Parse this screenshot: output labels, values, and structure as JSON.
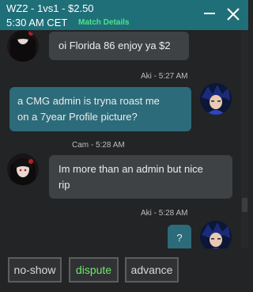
{
  "header": {
    "title": "WZ2 - 1vs1 - $2.50",
    "time": "5:30 AM CET",
    "details_link": "Match Details",
    "minimize_icon": "minimize-icon",
    "close_icon": "close-icon"
  },
  "messages": [
    {
      "author": "",
      "time": "",
      "side": "left",
      "text": "oi Florida 86 enjoy ya $2"
    },
    {
      "author": "Aki",
      "time": "5:27 AM",
      "meta": "Aki - 5:27 AM",
      "side": "right",
      "text_lines": [
        "a CMG admin is tryna roast me",
        "on a 7year Profile picture?"
      ]
    },
    {
      "author": "Cam",
      "time": "5:28 AM",
      "meta": "Cam - 5:28 AM",
      "side": "left",
      "text_lines": [
        "Im more than an admin but nice",
        "rip"
      ]
    },
    {
      "author": "Aki",
      "time": "5:28 AM",
      "meta": "Aki - 5:28 AM",
      "side": "right",
      "text": "?"
    }
  ],
  "actions": {
    "no_show": "no-show",
    "dispute": "dispute",
    "advance": "advance"
  },
  "colors": {
    "header_bg": "#1f6f78",
    "link_green": "#4fe38a",
    "dispute_green": "#6fe86a",
    "mine_bubble": "#2c6b7a",
    "theirs_bubble": "#3f4244"
  }
}
